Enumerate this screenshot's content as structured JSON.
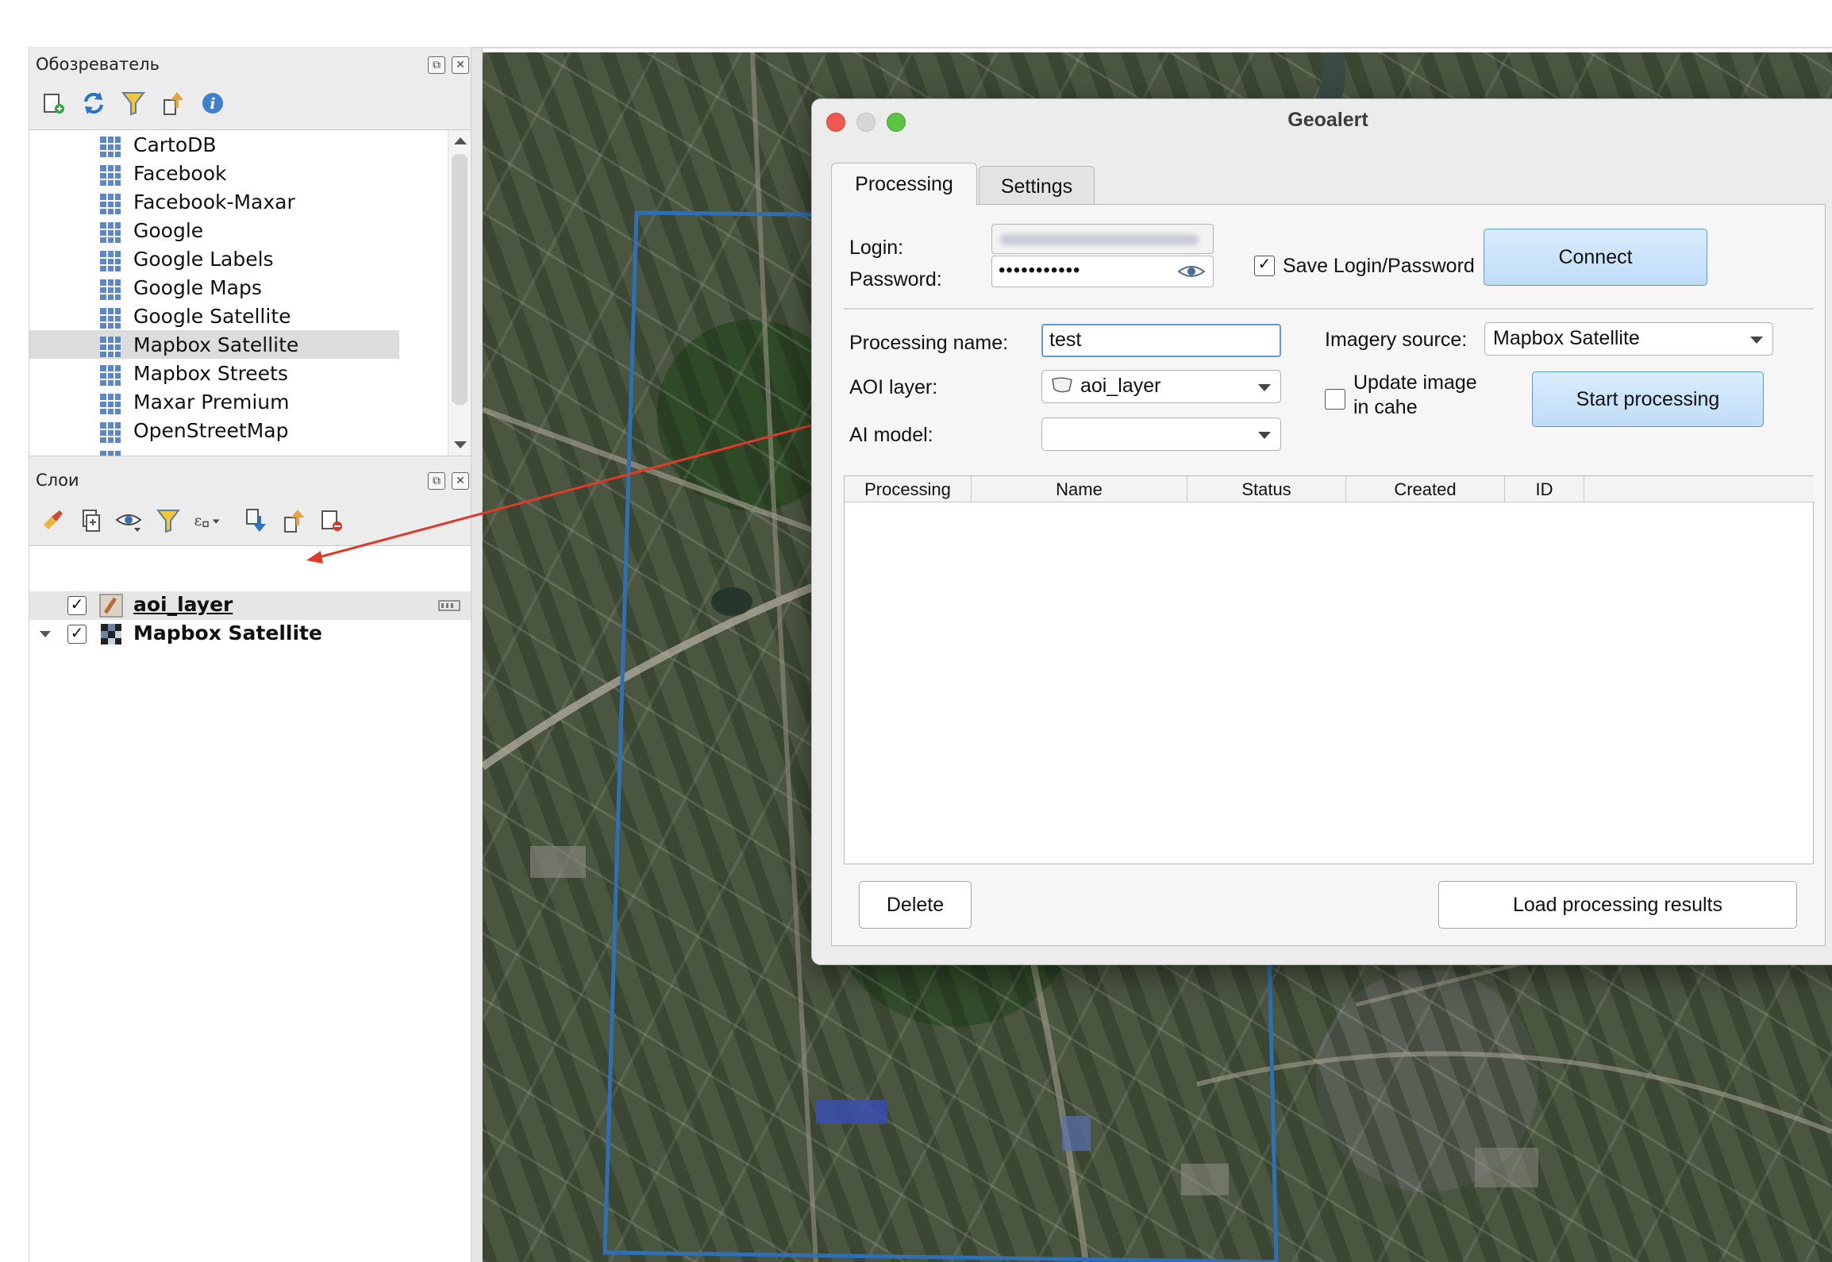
{
  "browser_panel": {
    "title": "Обозреватель",
    "items": [
      {
        "label": "CartoDB"
      },
      {
        "label": "Facebook"
      },
      {
        "label": "Facebook-Maxar"
      },
      {
        "label": "Google"
      },
      {
        "label": "Google Labels"
      },
      {
        "label": "Google Maps"
      },
      {
        "label": "Google Satellite"
      },
      {
        "label": "Mapbox Satellite",
        "selected": true
      },
      {
        "label": "Mapbox Streets"
      },
      {
        "label": "Maxar Premium"
      },
      {
        "label": "OpenStreetMap"
      }
    ]
  },
  "layers_panel": {
    "title": "Слои",
    "layers": [
      {
        "label": "aoi_layer",
        "checked": true,
        "icon": "polygon-layer-icon"
      },
      {
        "label": "Mapbox Satellite",
        "checked": true,
        "icon": "raster-layer-icon"
      }
    ]
  },
  "dialog": {
    "title": "Geoalert",
    "tabs": [
      {
        "label": "Processing",
        "active": true
      },
      {
        "label": "Settings",
        "active": false
      }
    ],
    "login_label": "Login:",
    "password_label": "Password:",
    "password_value": "•••••••••••",
    "save_login_label": "Save Login/Password",
    "save_login_checked": true,
    "connect_label": "Connect",
    "processing_name_label": "Processing name:",
    "processing_name_value": "test",
    "imagery_source_label": "Imagery source:",
    "imagery_source_value": "Mapbox Satellite",
    "aoi_layer_label": "AOI layer:",
    "aoi_layer_value": "aoi_layer",
    "update_image_label_line1": "Update image",
    "update_image_label_line2": "in cahe",
    "update_image_checked": false,
    "start_processing_label": "Start processing",
    "ai_model_label": "AI model:",
    "ai_model_value": "",
    "table_headers": [
      "Processing",
      "Name",
      "Status",
      "Created",
      "ID"
    ],
    "delete_label": "Delete",
    "load_results_label": "Load processing results"
  },
  "colors": {
    "accent_blue": "#5f98d4",
    "annotation_red": "#e03a2a",
    "aoi_outline": "#2f6fb5"
  }
}
